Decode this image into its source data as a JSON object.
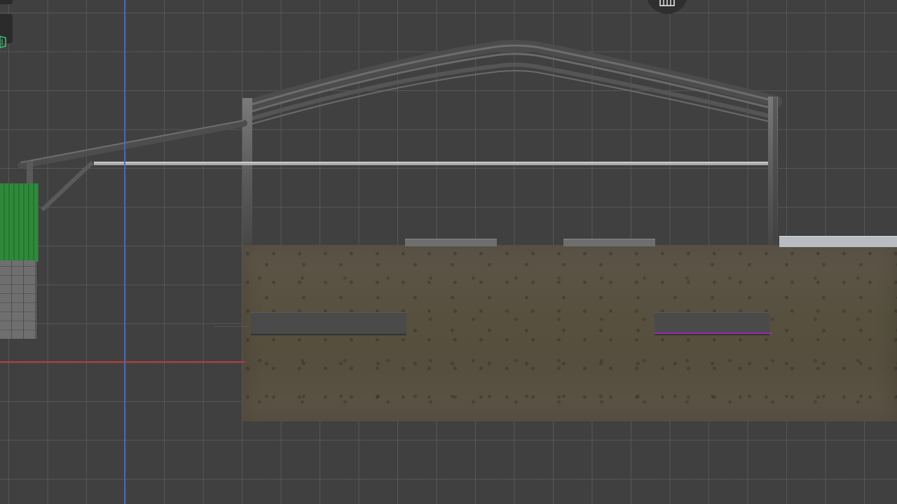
{
  "viewport": {
    "mode": "front-orthographic",
    "background": "#404040",
    "grid_color": "#5a5a5a",
    "axis_x_color": "#c53a3a",
    "axis_y_color": "#3b6fc9",
    "selection_color": "#9b2fa6"
  },
  "overlay": {
    "grid_toggle_icon": "grid-icon",
    "corner_icon": "layers-icon"
  },
  "scene": {
    "objects": [
      "truss-frame",
      "ground-slab",
      "green-corrugated-wall",
      "brick-wall",
      "canopy-beam"
    ]
  }
}
